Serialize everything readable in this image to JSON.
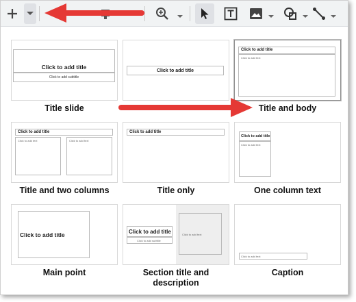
{
  "colors": {
    "toolbar_bg": "#f1f3f4",
    "annotation_arrow": "#e53935",
    "thumb_border": "#d8d8d8",
    "section_panel": "#eeeeee"
  },
  "toolbar": {
    "icons": [
      "plus-icon",
      "caret-down-icon",
      "zoom-icon",
      "cursor-icon",
      "text-box-icon",
      "image-icon",
      "shape-icon",
      "line-icon"
    ]
  },
  "layouts": [
    {
      "name": "Title slide",
      "title_placeholder": "Click to add title",
      "subtitle_placeholder": "Click to add subtitle"
    },
    {
      "name": "",
      "title_placeholder": "Click to add title"
    },
    {
      "name": "Title and body",
      "title_placeholder": "Click to add title",
      "body_placeholder": "Click to add text"
    },
    {
      "name": "Title and two columns",
      "title_placeholder": "Click to add title",
      "col1_placeholder": "Click to add text",
      "col2_placeholder": "Click to add text"
    },
    {
      "name": "Title only",
      "title_placeholder": "Click to add title"
    },
    {
      "name": "One column text",
      "title_placeholder": "Click to add title",
      "body_placeholder": "Click to add text"
    },
    {
      "name": "Main point",
      "title_placeholder": "Click to add title"
    },
    {
      "name": "Section title and description",
      "title_placeholder": "Click to add title",
      "subtitle_placeholder": "Click to add subtitle",
      "body_placeholder": "Click to add text"
    },
    {
      "name": "Caption",
      "body_placeholder": "Click to add text"
    }
  ]
}
